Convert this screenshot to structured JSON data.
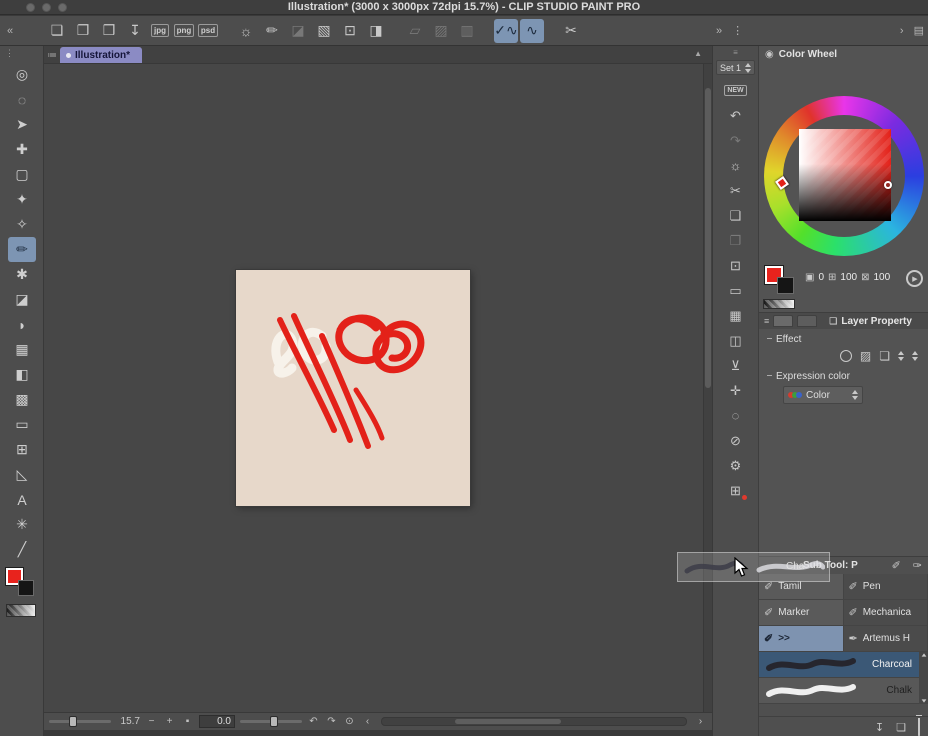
{
  "titlebar": {
    "title": "Illustration* (3000 x 3000px 72dpi 15.7%)  - CLIP STUDIO PAINT PRO"
  },
  "toolbar": {
    "collapse_icon": "«",
    "icons": [
      {
        "name": "new-file-button",
        "glyph": "❏"
      },
      {
        "name": "open-file-button",
        "glyph": "❐"
      },
      {
        "name": "save-file-button",
        "glyph": "❒"
      },
      {
        "name": "export-file-button",
        "glyph": "↧"
      },
      {
        "name": "export-jpg-button",
        "glyph": "jpg",
        "cls": "badge"
      },
      {
        "name": "export-png-button",
        "glyph": "png",
        "cls": "badge"
      },
      {
        "name": "export-psd-button",
        "glyph": "psd",
        "cls": "badge"
      },
      {
        "name": "airbrush-button",
        "glyph": "☼",
        "cls": "group"
      },
      {
        "name": "ruler-pen-button",
        "glyph": "✏"
      },
      {
        "name": "eraser-button",
        "glyph": "◪",
        "disabled": true
      },
      {
        "name": "tape-button",
        "glyph": "▧"
      },
      {
        "name": "crop-button",
        "glyph": "⊡"
      },
      {
        "name": "fill-button",
        "glyph": "◨"
      },
      {
        "name": "select-rect-button",
        "glyph": "▱",
        "disabled": true,
        "cls": "group"
      },
      {
        "name": "select-shrink-button",
        "glyph": "▨",
        "disabled": true
      },
      {
        "name": "select-clear-button",
        "glyph": "▥",
        "disabled": true
      },
      {
        "name": "correct-line-button",
        "glyph": "✓∿",
        "selected": true,
        "cls": "group"
      },
      {
        "name": "simplify-line-button",
        "glyph": "∿",
        "selected": true
      },
      {
        "name": "vector-eraser-button",
        "glyph": "✂",
        "cls": "group"
      }
    ],
    "right_icons": [
      {
        "name": "panels-expand-button",
        "glyph": "»"
      },
      {
        "name": "rail-handle-icon",
        "glyph": "⋮"
      }
    ],
    "far_right_icons": [
      {
        "name": "tool-scroll-right-button",
        "glyph": "›"
      },
      {
        "name": "toolbar-menu-button",
        "glyph": "▤"
      }
    ]
  },
  "left_tools": {
    "menu_icon": "⋮",
    "tools": [
      {
        "name": "zoom-tool",
        "glyph": "◎"
      },
      {
        "name": "lasso-select-tool",
        "glyph": "◌"
      },
      {
        "name": "object-select-tool",
        "glyph": "➤"
      },
      {
        "name": "move-tool",
        "glyph": "✚"
      },
      {
        "name": "marquee-select-tool",
        "glyph": "▢"
      },
      {
        "name": "auto-select-tool",
        "glyph": "✦"
      },
      {
        "name": "eyedropper-tool",
        "glyph": "✧"
      },
      {
        "name": "pencil-tool",
        "glyph": "✏",
        "selected": true
      },
      {
        "name": "airbrush-tool",
        "glyph": "✱"
      },
      {
        "name": "eraser-tool",
        "glyph": "◪"
      },
      {
        "name": "blend-tool",
        "glyph": "◗"
      },
      {
        "name": "tone-tool",
        "glyph": "▦"
      },
      {
        "name": "fill-tool",
        "glyph": "◧"
      },
      {
        "name": "gradient-tool",
        "glyph": "▩"
      },
      {
        "name": "figure-tool",
        "glyph": "▭"
      },
      {
        "name": "frame-border-tool",
        "glyph": "⊞"
      },
      {
        "name": "ruler-tool",
        "glyph": "◺"
      },
      {
        "name": "text-tool",
        "glyph": "A"
      },
      {
        "name": "decoration-tool",
        "glyph": "✳"
      },
      {
        "name": "line-tool",
        "glyph": "╱"
      }
    ]
  },
  "canvas": {
    "tab": "Illustration*",
    "menu_icon": "≔",
    "scroll_icon": "▲",
    "background": "#e7d8ca",
    "stroke_red": "#e32119",
    "stroke_white": "#f7f2ea"
  },
  "status_bar": {
    "zoom": "15.7",
    "minus_icon": "−",
    "plus_icon": "+",
    "fit_icon": "▪",
    "rotation": "0.0",
    "undo_icon": "↶",
    "redo_icon": "↷",
    "reset_icon": "⊙",
    "left_icon": "‹",
    "right_icon": "›"
  },
  "command_strip": {
    "handle_icon": "≡",
    "set_label": "Set 1",
    "icons": [
      {
        "name": "new-canvas-button",
        "glyph": "NEW",
        "cls": "new-badge"
      },
      {
        "name": "undo-button",
        "glyph": "↶"
      },
      {
        "name": "redo-button",
        "glyph": "↷",
        "disabled": true
      },
      {
        "name": "clear-layer-button",
        "glyph": "☼"
      },
      {
        "name": "cut-button",
        "glyph": "✂"
      },
      {
        "name": "copy-button",
        "glyph": "❏"
      },
      {
        "name": "paste-button",
        "glyph": "❐",
        "disabled": true
      },
      {
        "name": "crop-button",
        "glyph": "⊡"
      },
      {
        "name": "canvas-size-button",
        "glyph": "▭"
      },
      {
        "name": "image-size-button",
        "glyph": "▦"
      },
      {
        "name": "flip-horizontal-button",
        "glyph": "◫"
      },
      {
        "name": "merge-down-button",
        "glyph": "⊻"
      },
      {
        "name": "transform-button",
        "glyph": "✛"
      },
      {
        "name": "select-layer-button",
        "glyph": "◌"
      },
      {
        "name": "deselect-button",
        "glyph": "⊘"
      },
      {
        "name": "snap-settings-button",
        "glyph": "⚙"
      },
      {
        "name": "new-layer-button",
        "glyph": "⊞",
        "accent": true
      }
    ]
  },
  "color_wheel": {
    "title": "Color Wheel",
    "header_icon": "◉",
    "monitor_icon": "▣",
    "hue": "0",
    "box1_icon": "⊞",
    "sat": "100",
    "box2_icon": "⊠",
    "val": "100",
    "play_icon": "▶",
    "fg_color": "#e8231d",
    "bg_color": "#151515"
  },
  "layer_property": {
    "menu_icon": "≡",
    "title_icon": "❏",
    "title": "Layer Property",
    "effect_label": "Effect",
    "effect_icons": [
      {
        "name": "tone-effect-icon",
        "glyph": "▨"
      },
      {
        "name": "layer-color-effect-icon",
        "glyph": "❏"
      }
    ],
    "expression_label": "Expression color",
    "color_mode": "Color"
  },
  "sub_tool": {
    "title": "Sub Tool: P",
    "pen_icons": [
      {
        "name": "subtool-pen-icon-1",
        "glyph": "✐"
      },
      {
        "name": "subtool-pen-icon-2",
        "glyph": "✑"
      }
    ],
    "grid": [
      {
        "name": "subtool-tamil",
        "label": "Tamil",
        "icon": "✐",
        "shade": "light"
      },
      {
        "name": "subtool-pen",
        "label": "Pen",
        "icon": "✐",
        "shade": "dark"
      },
      {
        "name": "subtool-marker",
        "label": "Marker",
        "icon": "✐",
        "shade": "light"
      },
      {
        "name": "subtool-mechanical",
        "label": "Mechanica",
        "icon": "✐",
        "shade": "dark"
      },
      {
        "name": "subtool-expand",
        "label": ">>",
        "icon": "✐",
        "selected": true
      },
      {
        "name": "subtool-artemus",
        "label": "Artemus H",
        "icon": "✒",
        "shade": "dark"
      }
    ],
    "brushes": [
      {
        "name": "subtool-charcoal",
        "label": "Charcoal",
        "selected": true,
        "stroke_color": "#26262e"
      },
      {
        "name": "subtool-chalk",
        "label": "Chalk",
        "stroke_color": "#efefef"
      }
    ],
    "bottom_icons": [
      {
        "name": "save-settings-button",
        "glyph": "↧"
      },
      {
        "name": "duplicate-subtool-button",
        "glyph": "❏"
      }
    ]
  },
  "ghost": {
    "label": "Cha"
  }
}
